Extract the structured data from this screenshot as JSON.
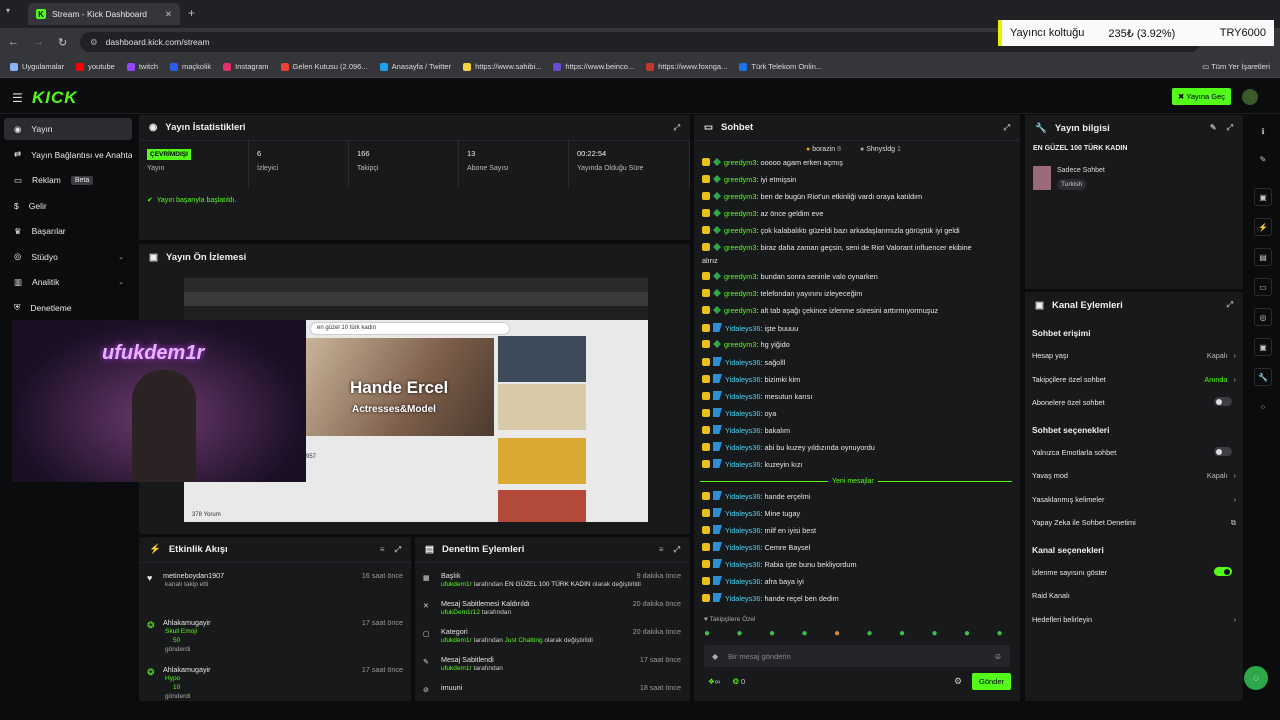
{
  "browser": {
    "tab_title": "Stream - Kick Dashboard",
    "url": "dashboard.kick.com/stream",
    "all_bookmarks": "Tüm Yer İşaretleri",
    "bookmarks": [
      {
        "label": "Uygulamalar",
        "color": "#8ab4f8"
      },
      {
        "label": "youtube",
        "color": "#ff0000"
      },
      {
        "label": "twitch",
        "color": "#9146ff"
      },
      {
        "label": "maçkolik",
        "color": "#2b5ee8"
      },
      {
        "label": "Instagram",
        "color": "#e1306c"
      },
      {
        "label": "Gelen Kutusu (2.096...",
        "color": "#ea4335"
      },
      {
        "label": "Anasayfa / Twitter",
        "color": "#1da1f2"
      },
      {
        "label": "https://www.sahibi...",
        "color": "#f4d03f"
      },
      {
        "label": "https://www.beinco...",
        "color": "#6b4bd6"
      },
      {
        "label": "https://www.foxnga...",
        "color": "#c0392b"
      },
      {
        "label": "Türk Telekom Onlin...",
        "color": "#1a73e8"
      }
    ]
  },
  "ticker": {
    "label": "Yayıncı koltuğu",
    "value": "235₺ (3.92%)",
    "goal": "TRY6000"
  },
  "topbar": {
    "logo": "KICK",
    "go_live": "Yayına Geç"
  },
  "sidebar": [
    {
      "label": "Yayın",
      "icon": "broadcast-icon",
      "active": true
    },
    {
      "label": "Yayın Bağlantısı ve Anahtarı",
      "icon": "link-icon"
    },
    {
      "label": "Reklam",
      "icon": "ad-icon",
      "badge": "Beta"
    },
    {
      "label": "Gelir",
      "icon": "money-icon"
    },
    {
      "label": "Başarılar",
      "icon": "trophy-icon"
    },
    {
      "label": "Stüdyo",
      "icon": "studio-icon",
      "chev": true
    },
    {
      "label": "Analitik",
      "icon": "chart-icon",
      "chev": true
    },
    {
      "label": "Denetleme",
      "icon": "shield-icon"
    }
  ],
  "stats": {
    "title": "Yayın İstatistikleri",
    "items": [
      {
        "value": "ÇEVRİMDIŞI",
        "label": "Yayın",
        "badge": true
      },
      {
        "value": "6",
        "label": "İzleyici"
      },
      {
        "value": "166",
        "label": "Takipçi"
      },
      {
        "value": "13",
        "label": "Abone Sayısı"
      },
      {
        "value": "00:22:54",
        "label": "Yayında Olduğu Süre"
      }
    ],
    "success": "Yayın başarıyla başlatıldı."
  },
  "preview": {
    "title": "Yayın Ön İzlemesi",
    "streamer": "ufukdem1r",
    "search": "en güzel 10 türk kadın",
    "hero": "Hande Ercel",
    "hero_sub": "Actresses&Model",
    "comments": "378 Yorum",
    "likes": "957"
  },
  "chat": {
    "title": "Sohbet",
    "viewers": [
      {
        "name": "borazin",
        "n": "8"
      },
      {
        "name": "Shnysldg",
        "n": "1"
      }
    ],
    "new_label": "Yeni mesajlar",
    "messages": [
      {
        "u": "greedym3",
        "m": "ooooo agam erken açmış",
        "b": false
      },
      {
        "u": "greedym3",
        "m": "iyi etmişsin",
        "b": false
      },
      {
        "u": "greedym3",
        "m": "ben de bugün Riot'un etkinliği vardı oraya katıldım",
        "b": false
      },
      {
        "u": "greedym3",
        "m": "az önce geldim eve",
        "b": false
      },
      {
        "u": "greedym3",
        "m": "çok kalabalıktı güzeldi bazı arkadaşlarımızla görüştük iyi geldi",
        "b": false
      },
      {
        "u": "greedym3",
        "m": "biraz daha zaman geçsin, seni de Riot Valorant influencer ekibine",
        "m2": "alırız",
        "b": false
      },
      {
        "u": "greedym3",
        "m": "bundan sonra seninle valo oynarken",
        "b": false
      },
      {
        "u": "greedym3",
        "m": "telefondan yayınını izleyeceğim",
        "b": false
      },
      {
        "u": "greedym3",
        "m": "alt tab aşağı çekince izlenme süresini arttırmıyormuşuz",
        "b": false
      },
      {
        "u": "Yidaleys36",
        "m": "işte buuuu",
        "b": true
      },
      {
        "u": "greedym3",
        "m": "hg yiğido",
        "b": false
      },
      {
        "u": "Yidaleys36",
        "m": "sağolll",
        "b": true
      },
      {
        "u": "Yidaleys36",
        "m": "bizimki kim",
        "b": true
      },
      {
        "u": "Yidaleys36",
        "m": "mesutun karısı",
        "b": true
      },
      {
        "u": "Yidaleys36",
        "m": "oya",
        "b": true
      },
      {
        "u": "Yidaleys36",
        "m": "bakalım",
        "b": true
      },
      {
        "u": "Yidaleys36",
        "m": "abi bu kuzey yıldızında oynuyordu",
        "b": true
      },
      {
        "u": "Yidaleys36",
        "m": "kuzeyin kızı",
        "b": true
      },
      {
        "u": "Yidaleys36",
        "m": "hande erçelmi",
        "b": true
      },
      {
        "u": "Yidaleys36",
        "m": "Mine tugay",
        "b": true
      },
      {
        "u": "Yidaleys36",
        "m": "milf en iyisi best",
        "b": true
      },
      {
        "u": "Yidaleys36",
        "m": "Cemre Baysel",
        "b": true
      },
      {
        "u": "Yidaleys36",
        "m": "Rabia işte bunu bekliyordum",
        "b": true
      },
      {
        "u": "Yidaleys36",
        "m": "afra baya iyi",
        "b": true
      },
      {
        "u": "Yidaleys36",
        "m": "hande reçel ben dedim",
        "b": true
      }
    ],
    "followers_only": "Takipçilere Özel",
    "placeholder": "Bir mesaj gönderin",
    "send": "Gönder",
    "points1": "∞",
    "points2": "0"
  },
  "events": {
    "title": "Etkinlik Akışı",
    "items": [
      {
        "name": "metineboydan1907",
        "sub": "kanalı takip etti",
        "time": "16 saat önce"
      },
      {
        "name": "Ahlakamugayir",
        "sub": "Skull Emoji",
        "sub2": "50",
        "sub3": "gönderdi",
        "time": "17 saat önce"
      },
      {
        "name": "Ahlakamugayir",
        "sub": "Hypo",
        "sub2": "10",
        "sub3": "gönderdi",
        "time": "17 saat önce"
      }
    ]
  },
  "modlog": {
    "title": "Denetim Eylemleri",
    "items": [
      {
        "title": "Başlık",
        "by": "ufukdem1r",
        "text": "tarafından",
        "val": "EN GÜZEL 100 TÜRK KADIN",
        "tail": "olarak değiştirildi",
        "time": "9 dakika önce",
        "icon": "title-icon"
      },
      {
        "title": "Mesaj Sabitlemesi Kaldırıldı",
        "by": "ufukDem1r12",
        "text": "tarafından",
        "val": "",
        "tail": "",
        "time": "20 dakika önce",
        "icon": "unpin-icon"
      },
      {
        "title": "Kategori",
        "by": "ufukdem1r",
        "text": "tarafından",
        "val": "Just Chatting",
        "tail": "olarak değiştirildi",
        "time": "20 dakika önce",
        "icon": "category-icon"
      },
      {
        "title": "Mesaj Sabitlendi",
        "by": "ufukdem1r",
        "text": "tarafından",
        "val": "",
        "tail": "",
        "time": "17 saat önce",
        "icon": "pin-icon"
      },
      {
        "title": "imuuni",
        "by": "",
        "text": "",
        "val": "",
        "tail": "",
        "time": "18 saat önce",
        "icon": "ban-icon"
      }
    ]
  },
  "info": {
    "title": "Yayın bilgisi",
    "stream_title": "EN GÜZEL 100 TÜRK KADIN",
    "category": "Sadece Sohbet",
    "language": "Turkish"
  },
  "actions": {
    "title": "Kanal Eylemleri",
    "s1": "Sohbet erişimi",
    "rows1": [
      {
        "label": "Hesap yaşı",
        "val": "Kapalı",
        "type": "chev"
      },
      {
        "label": "Takipçilere özel sohbet",
        "val": "Anında",
        "type": "chev",
        "green": true
      },
      {
        "label": "Abonelere özel sohbet",
        "type": "toggle",
        "on": false
      }
    ],
    "s2": "Sohbet seçenekleri",
    "rows2": [
      {
        "label": "Yalnızca Emotlarla sohbet",
        "type": "toggle",
        "on": false
      },
      {
        "label": "Yavaş mod",
        "val": "Kapalı",
        "type": "chev"
      },
      {
        "label": "Yasaklanmış kelimeler",
        "type": "chev"
      },
      {
        "label": "Yapay Zeka ile Sohbet Denetimi",
        "type": "ext"
      }
    ],
    "s3": "Kanal seçenekleri",
    "rows3": [
      {
        "label": "İzlenme sayısını göster",
        "type": "toggle",
        "on": true
      },
      {
        "label": "Raid Kanalı",
        "type": "none"
      },
      {
        "label": "Hedefleri belirleyin",
        "type": "chev"
      }
    ]
  }
}
